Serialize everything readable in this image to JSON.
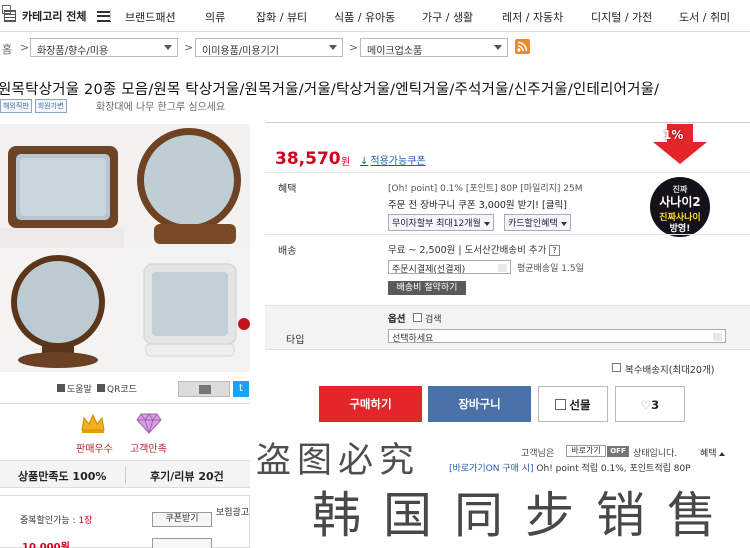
{
  "topnav": {
    "all_label": "카테고리 전체",
    "items": [
      "브랜드패션",
      "의류",
      "잡화 / 뷰티",
      "식품 / 유아동",
      "가구 / 생활",
      "레저 / 자동차",
      "디지털 / 가전",
      "도서 / 취미"
    ]
  },
  "breadcrumb": {
    "home": "홈",
    "levels": [
      "화장품/향수/미용",
      "이미용품/미용기기",
      "메이크업소품"
    ],
    "rss": "RSS"
  },
  "product": {
    "title": "원목탁상거울 20종 모음/원목 탁상거울/원목거울/거울/탁상거울/엔틱거울/주석거울/신주거울/인테리어거울/",
    "badges": [
      "해외직판",
      "회원가변"
    ],
    "subtitle": "화장대에 나무 한그루 심으세요"
  },
  "image_controls": {
    "zoom_label": "도움말",
    "qr_label": "QR코드",
    "twitter": "t"
  },
  "awards": {
    "sales": "판매우수",
    "satisfaction": "고객만족"
  },
  "satisfaction": {
    "product_label": "상품만족도 100%",
    "review_label": "후기/리뷰 20건"
  },
  "coupon": {
    "dup_label": "중복할인가능 : ",
    "dup_count": "1장",
    "get_label": "쿠폰받기",
    "side_label": "보험광고",
    "price_partial": "10,000원"
  },
  "price": {
    "amount": "38,570",
    "unit": "원",
    "coupon_link": "적용가능쿠폰",
    "discount_badge": "1%"
  },
  "banner": {
    "line1": "진짜",
    "line2": "사나이2",
    "line3": "진짜사나이",
    "line4": "방영!"
  },
  "benefits": {
    "label": "혜택",
    "points_line": "[Oh! point] 0.1%  [포인트] 80P  [마일리지] 25M",
    "coupon_line": "주문 전 장바구니 쿠폰 3,000원 받기! [클릭]",
    "pill1": "무이자할부 최대12개월",
    "pill2": "카드할인혜택"
  },
  "shipping": {
    "label": "배송",
    "price": "무료 ~ 2,500원  |  도서산간배송비 추가",
    "select_value": "주문시결제(선결제)",
    "avg": "평균배송일 1.5일",
    "save_btn": "배송비 절약하기"
  },
  "option": {
    "header": "옵션",
    "search": "검색",
    "type_label": "타입",
    "select_value": "선택하세요"
  },
  "multi_ship": "복수배송지(최대20개)",
  "buttons": {
    "buy": "구매하기",
    "cart": "장바구니",
    "gift": "선물",
    "like_count": "3"
  },
  "customer": {
    "label": "고객님은",
    "pill": "바로가기",
    "off": "OFF",
    "status": "상태입니다.",
    "benefit": "혜택",
    "point_prefix": "[바로가기ON 구매 시]",
    "point_rest": "Oh! point 적립 0.1%, 포인트적립 80P"
  },
  "watermark": {
    "line1": "盗图必究",
    "line2": "韩国同步销售"
  },
  "colors": {
    "accent_red": "#d1001f",
    "cart_blue": "#4a72a8",
    "buy_red": "#e3262a"
  }
}
